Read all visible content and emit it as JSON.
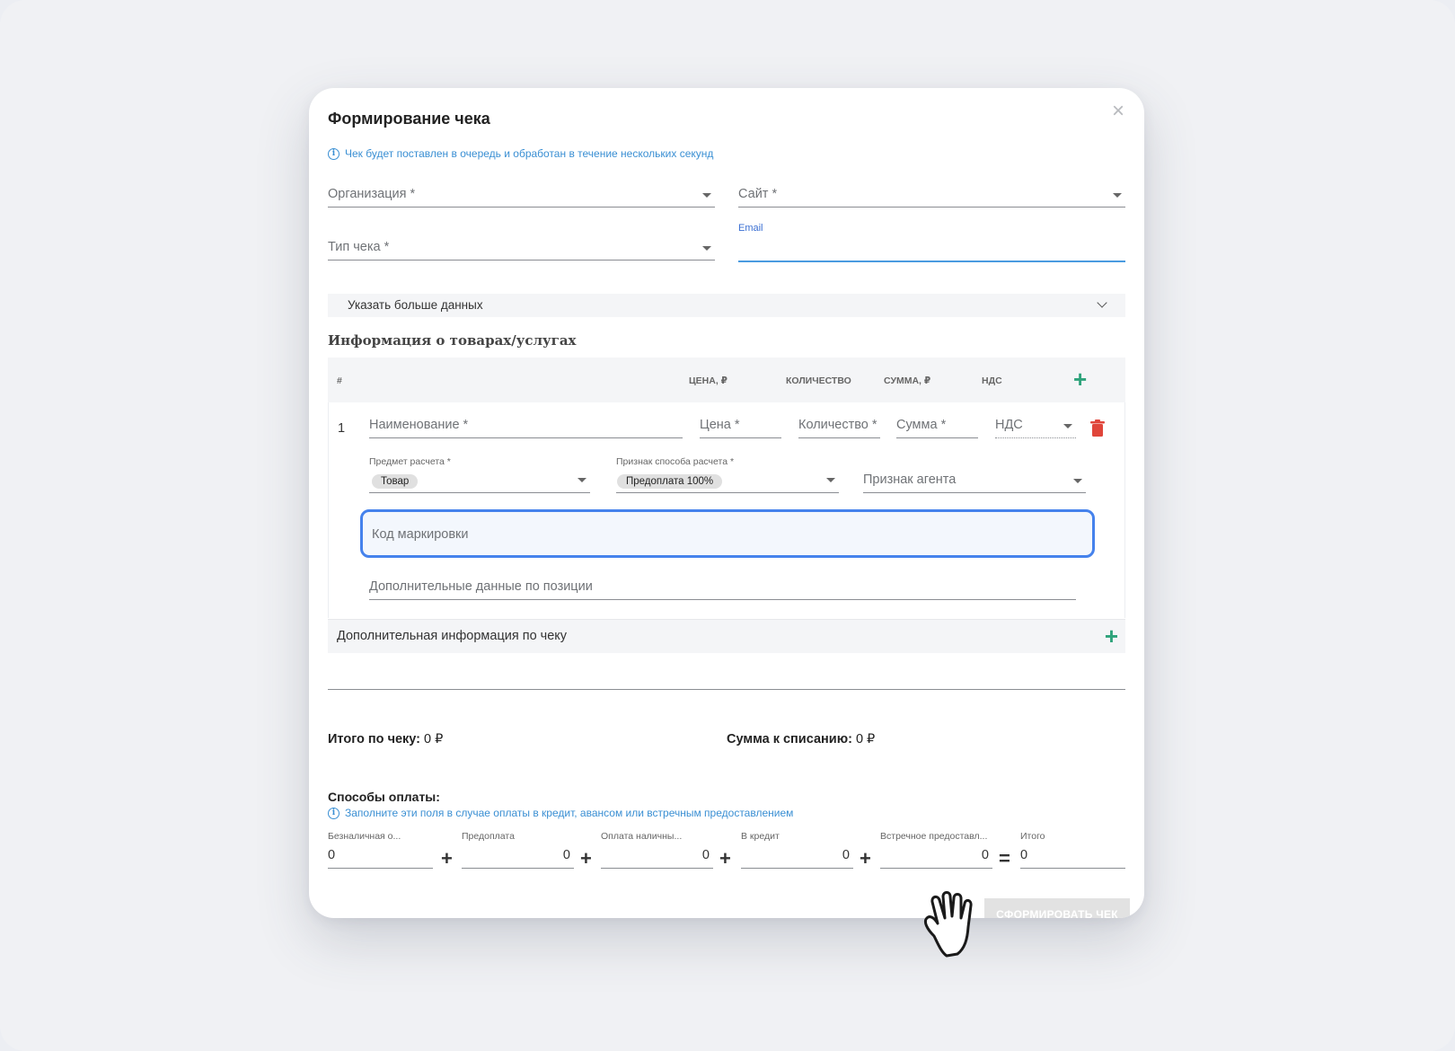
{
  "modal": {
    "title": "Формирование чека",
    "close": "×",
    "notice": "Чек будет поставлен в очередь и обработан в течение нескольких секунд"
  },
  "form": {
    "organization": "Организация *",
    "site": "Сайт *",
    "receipt_type": "Тип чека *",
    "email_label": "Email",
    "more_data": "Указать больше данных"
  },
  "items": {
    "section_title": "Информация о товарах/услугах",
    "columns": [
      "#",
      "ЦЕНА, ₽",
      "КОЛИЧЕСТВО",
      "СУММА, ₽",
      "НДС"
    ],
    "row": {
      "index": "1",
      "name_placeholder": "Наименование *",
      "price_placeholder": "Цена *",
      "qty_placeholder": "Количество *",
      "sum_placeholder": "Сумма *",
      "vat_placeholder": "НДС",
      "subject_label": "Предмет расчета *",
      "subject_value": "Товар",
      "method_label": "Признак способа расчета *",
      "method_value": "Предоплата 100%",
      "agent_placeholder": "Признак агента",
      "marking_placeholder": "Код маркировки",
      "additional_placeholder": "Дополнительные данные по позиции"
    },
    "extra_info": "Дополнительная информация по чеку"
  },
  "totals": {
    "receipt_total_label": "Итого по чеку:",
    "receipt_total_value": "0 ₽",
    "charge_label": "Сумма к списанию:",
    "charge_value": "0 ₽"
  },
  "payments": {
    "title": "Способы оплаты:",
    "notice": "Заполните эти поля в случае оплаты в кредит, авансом или встречным предоставлением",
    "fields": [
      {
        "label": "Безналичная о...",
        "value": "0"
      },
      {
        "label": "Предоплата",
        "value": "0"
      },
      {
        "label": "Оплата наличны...",
        "value": "0"
      },
      {
        "label": "В кредит",
        "value": "0"
      },
      {
        "label": "Встречное предоставл...",
        "value": "0"
      },
      {
        "label": "Итого",
        "value": "0"
      }
    ],
    "ops": [
      "+",
      "+",
      "+",
      "+",
      "="
    ]
  },
  "submit_label": "СФОРМИРОВАТЬ ЧЕК",
  "colors": {
    "accent_green": "#2ea37b",
    "info_blue": "#3a8fd3",
    "focus_blue": "#4582ec",
    "delete_red": "#e0453a"
  }
}
